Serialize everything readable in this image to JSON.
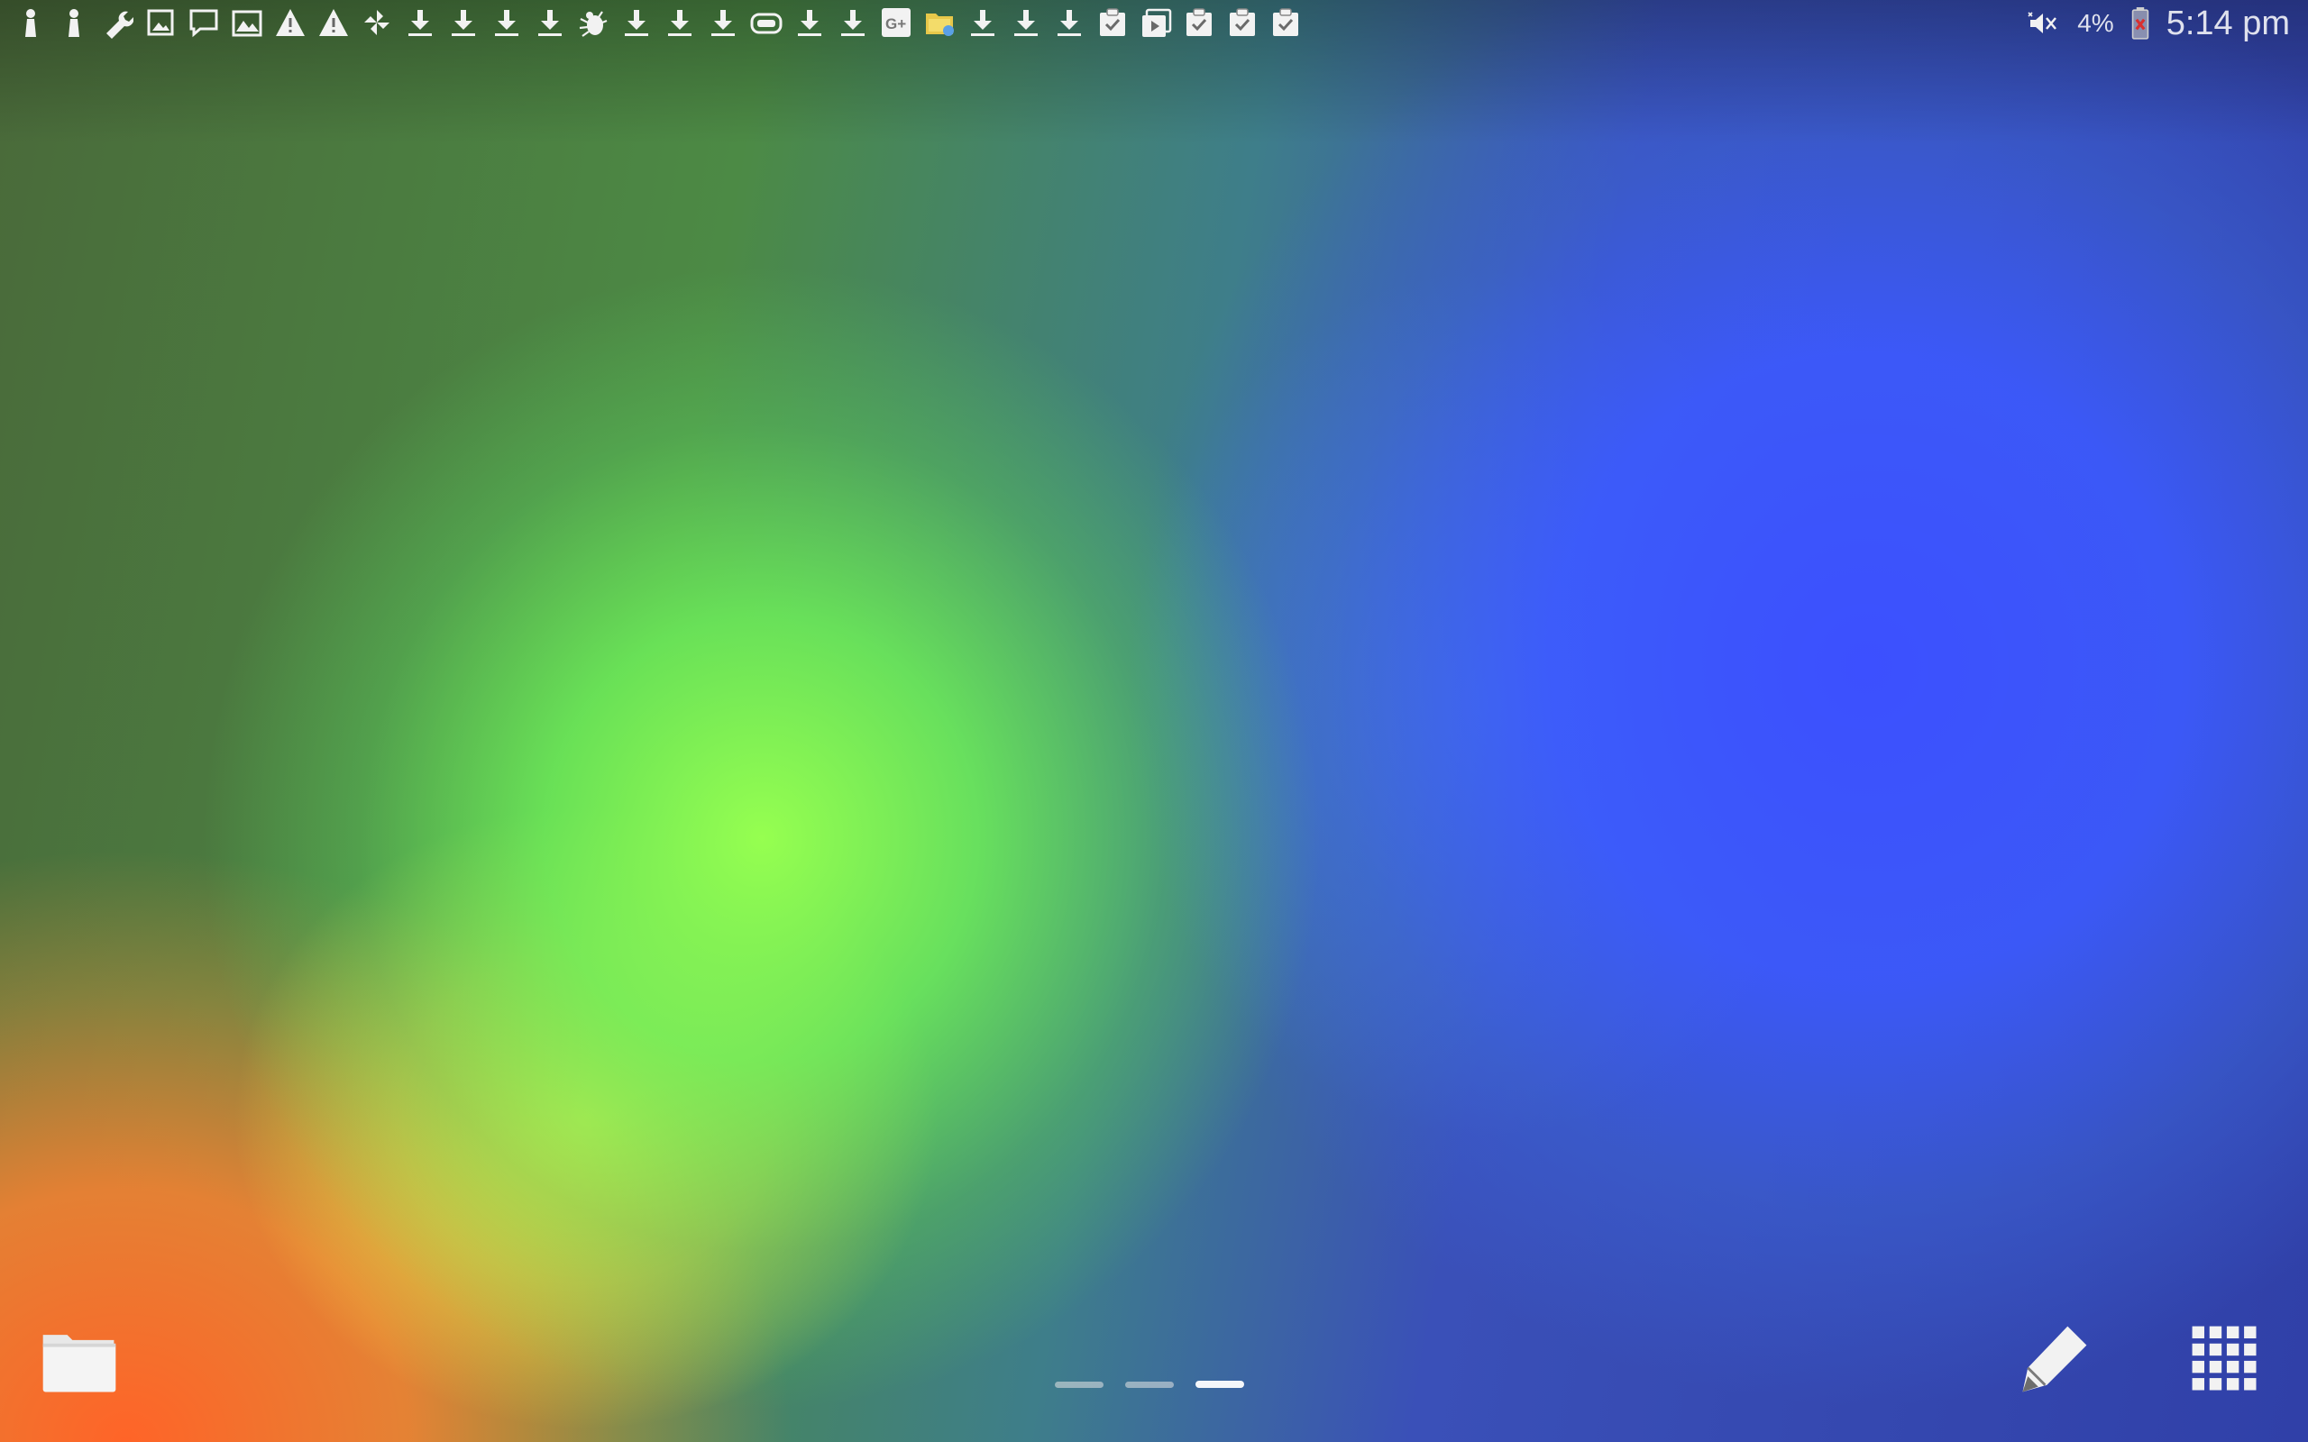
{
  "status_bar": {
    "notification_icons": [
      "person-silhouette-icon",
      "person-silhouette-icon",
      "wrench-icon",
      "image-icon",
      "chat-bubble-icon",
      "gallery-icon",
      "warning-icon",
      "warning-icon",
      "pinwheel-icon",
      "download-icon",
      "download-icon",
      "download-icon",
      "download-icon",
      "bug-icon",
      "download-icon",
      "download-icon",
      "download-icon",
      "gamepad-icon",
      "download-icon",
      "download-icon",
      "google-plus-icon",
      "file-manager-icon",
      "download-icon",
      "download-icon",
      "download-icon",
      "clipboard-check-icon",
      "clipboard-play-icon",
      "clipboard-check-icon",
      "clipboard-check-icon",
      "clipboard-check-icon"
    ],
    "right_icons": [
      "mute-icon",
      "battery-low-icon"
    ],
    "battery_percent": "4%",
    "time": "5:14 pm"
  },
  "home": {
    "dock_icons": [
      "folder-icon",
      "pencil-icon",
      "app-grid-icon"
    ],
    "pages_total": 3,
    "active_page": 3
  },
  "colors": {
    "icon_white": "#f2f2f2",
    "battery_warn": "#d93030",
    "wallpaper_green": "#66ff55",
    "wallpaper_blue": "#3a4dff",
    "wallpaper_orange": "#ff6a30",
    "wallpaper_yellow": "#ffff55"
  }
}
